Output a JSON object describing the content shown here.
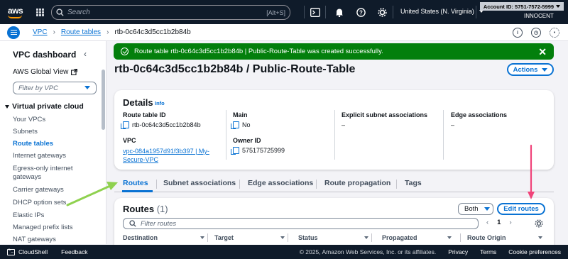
{
  "topnav": {
    "logo": "aws",
    "search_placeholder": "Search",
    "search_shortcut": "[Alt+S]",
    "region": "United States (N. Virginia)",
    "account": "Account ID: 5751-7572-5999",
    "user": "INNOCENT"
  },
  "breadcrumb": {
    "items": [
      "VPC",
      "Route tables"
    ],
    "current": "rtb-0c64c3d5cc1b2b84b"
  },
  "sidebar": {
    "title": "VPC dashboard",
    "global_view": "AWS Global View",
    "filter_placeholder": "Filter by VPC",
    "section": "Virtual private cloud",
    "items": [
      {
        "label": "Your VPCs"
      },
      {
        "label": "Subnets"
      },
      {
        "label": "Route tables"
      },
      {
        "label": "Internet gateways"
      },
      {
        "label": "Egress-only internet gateways"
      },
      {
        "label": "Carrier gateways"
      },
      {
        "label": "DHCP option sets"
      },
      {
        "label": "Elastic IPs"
      },
      {
        "label": "Managed prefix lists"
      },
      {
        "label": "NAT gateways"
      }
    ]
  },
  "flash": {
    "message": "Route table rtb-0c64c3d5cc1b2b84b | Public-Route-Table was created successfully."
  },
  "page": {
    "title": "rtb-0c64c3d5cc1b2b84b / Public-Route-Table",
    "actions_label": "Actions"
  },
  "details": {
    "title": "Details",
    "info": "Info",
    "route_table_id_label": "Route table ID",
    "route_table_id": "rtb-0c64c3d5cc1b2b84b",
    "main_label": "Main",
    "main_value": "No",
    "explicit_label": "Explicit subnet associations",
    "explicit_value": "–",
    "edge_label": "Edge associations",
    "edge_value": "–",
    "vpc_label": "VPC",
    "vpc_value": "vpc-084a1957d91f3b397 | My-Secure-VPC",
    "owner_label": "Owner ID",
    "owner_value": "575175725999"
  },
  "tabs": [
    "Routes",
    "Subnet associations",
    "Edge associations",
    "Route propagation",
    "Tags"
  ],
  "routes": {
    "title": "Routes",
    "count": "(1)",
    "both_label": "Both",
    "edit_label": "Edit routes",
    "filter_placeholder": "Filter routes",
    "page_num": "1",
    "columns": [
      "Destination",
      "Target",
      "Status",
      "Propagated",
      "Route Origin"
    ]
  },
  "footer": {
    "cloudshell": "CloudShell",
    "feedback": "Feedback",
    "copyright": "© 2025, Amazon Web Services, Inc. or its affiliates.",
    "privacy": "Privacy",
    "terms": "Terms",
    "cookies": "Cookie preferences"
  },
  "colors": {
    "accent": "#0972d3",
    "success": "#037f0c",
    "nav_bg": "#0f1b2a",
    "annotation_green": "#8fd14f",
    "annotation_pink": "#f0447a"
  }
}
